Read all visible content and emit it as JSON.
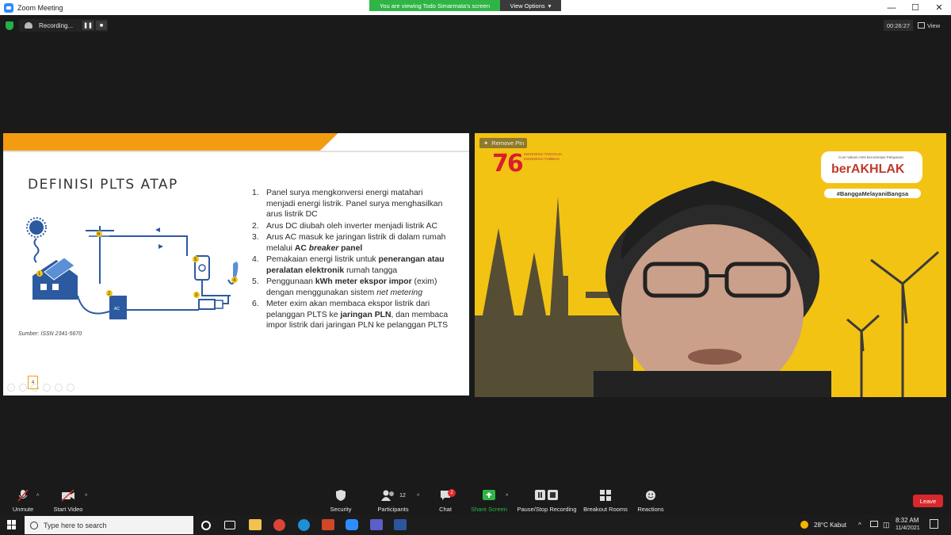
{
  "window": {
    "title": "Zoom Meeting"
  },
  "banner": {
    "viewing": "You are viewing Todo Simarmata's screen",
    "view_options": "View Options"
  },
  "window_controls": {
    "minimize": "—",
    "maximize": "☐",
    "close": "✕"
  },
  "recording": {
    "label": "Recording...",
    "pause": "❚❚",
    "stop": "■"
  },
  "timer": "00:26:27",
  "view": {
    "label": "View"
  },
  "slide": {
    "title": "DEFINISI PLTS ATAP",
    "items": [
      {
        "num": "1.",
        "text": "Panel surya mengkonversi energi matahari menjadi energi listrik. Panel surya menghasilkan arus listrik DC"
      },
      {
        "num": "2.",
        "text": "Arus DC diubah oleh inverter menjadi listrik AC"
      },
      {
        "num": "3.",
        "text_a": "Arus AC masuk ke jaringan listrik di dalam rumah melalui ",
        "bold_a": "AC ",
        "bold_italic": "breaker",
        "bold_b": " panel"
      },
      {
        "num": "4.",
        "text_a": "Pemakaian energi listrik untuk ",
        "bold": "penerangan atau peralatan elektronik",
        "text_b": " rumah tangga"
      },
      {
        "num": "5.",
        "text_a": "Penggunaan ",
        "bold": "kWh meter ekspor impor",
        "text_b": " (exim) dengan menggunakan sistem ",
        "italic": "net metering"
      },
      {
        "num": "6.",
        "text_a": "Meter exim akan membaca ekspor listrik dari pelanggan PLTS ke ",
        "bold": "jaringan PLN",
        "text_b": ", dan membaca impor listrik dari jaringan PLN ke pelanggan PLTS"
      }
    ],
    "source": "Sumber: ISSN 2341-5670",
    "page_number": "4",
    "diagram_labels": [
      "1",
      "2",
      "3",
      "4",
      "5",
      "6"
    ],
    "diagram_inverter_text": "AC"
  },
  "video": {
    "remove_pin": "Remove Pin",
    "big_number": "76",
    "number_sub": "INDONESIA TANGGUH INDONESIA TUMBUH",
    "akhlak_small": "Core Values ASN berorientasi Pelayanan",
    "akhlak_main": "berAKHLAK",
    "hashtag": "#BanggaMelayaniBangsa"
  },
  "toolbar": {
    "unmute": "Unmute",
    "start_video": "Start Video",
    "security": "Security",
    "participants": "Participants",
    "participants_count": "12",
    "chat": "Chat",
    "chat_badge": "2",
    "share_screen": "Share Screen",
    "pause_stop_recording": "Pause/Stop Recording",
    "breakout_rooms": "Breakout Rooms",
    "reactions": "Reactions",
    "leave": "Leave"
  },
  "taskbar": {
    "search_placeholder": "Type here to search",
    "weather": "28°C  Kabut",
    "time": "8:32 AM",
    "date": "11/4/2021"
  },
  "colors": {
    "zoom_blue": "#2d8cff",
    "banner_green": "#2fb546",
    "slide_orange": "#f39c12",
    "video_yellow": "#f3c314",
    "leave_red": "#d8272d"
  }
}
